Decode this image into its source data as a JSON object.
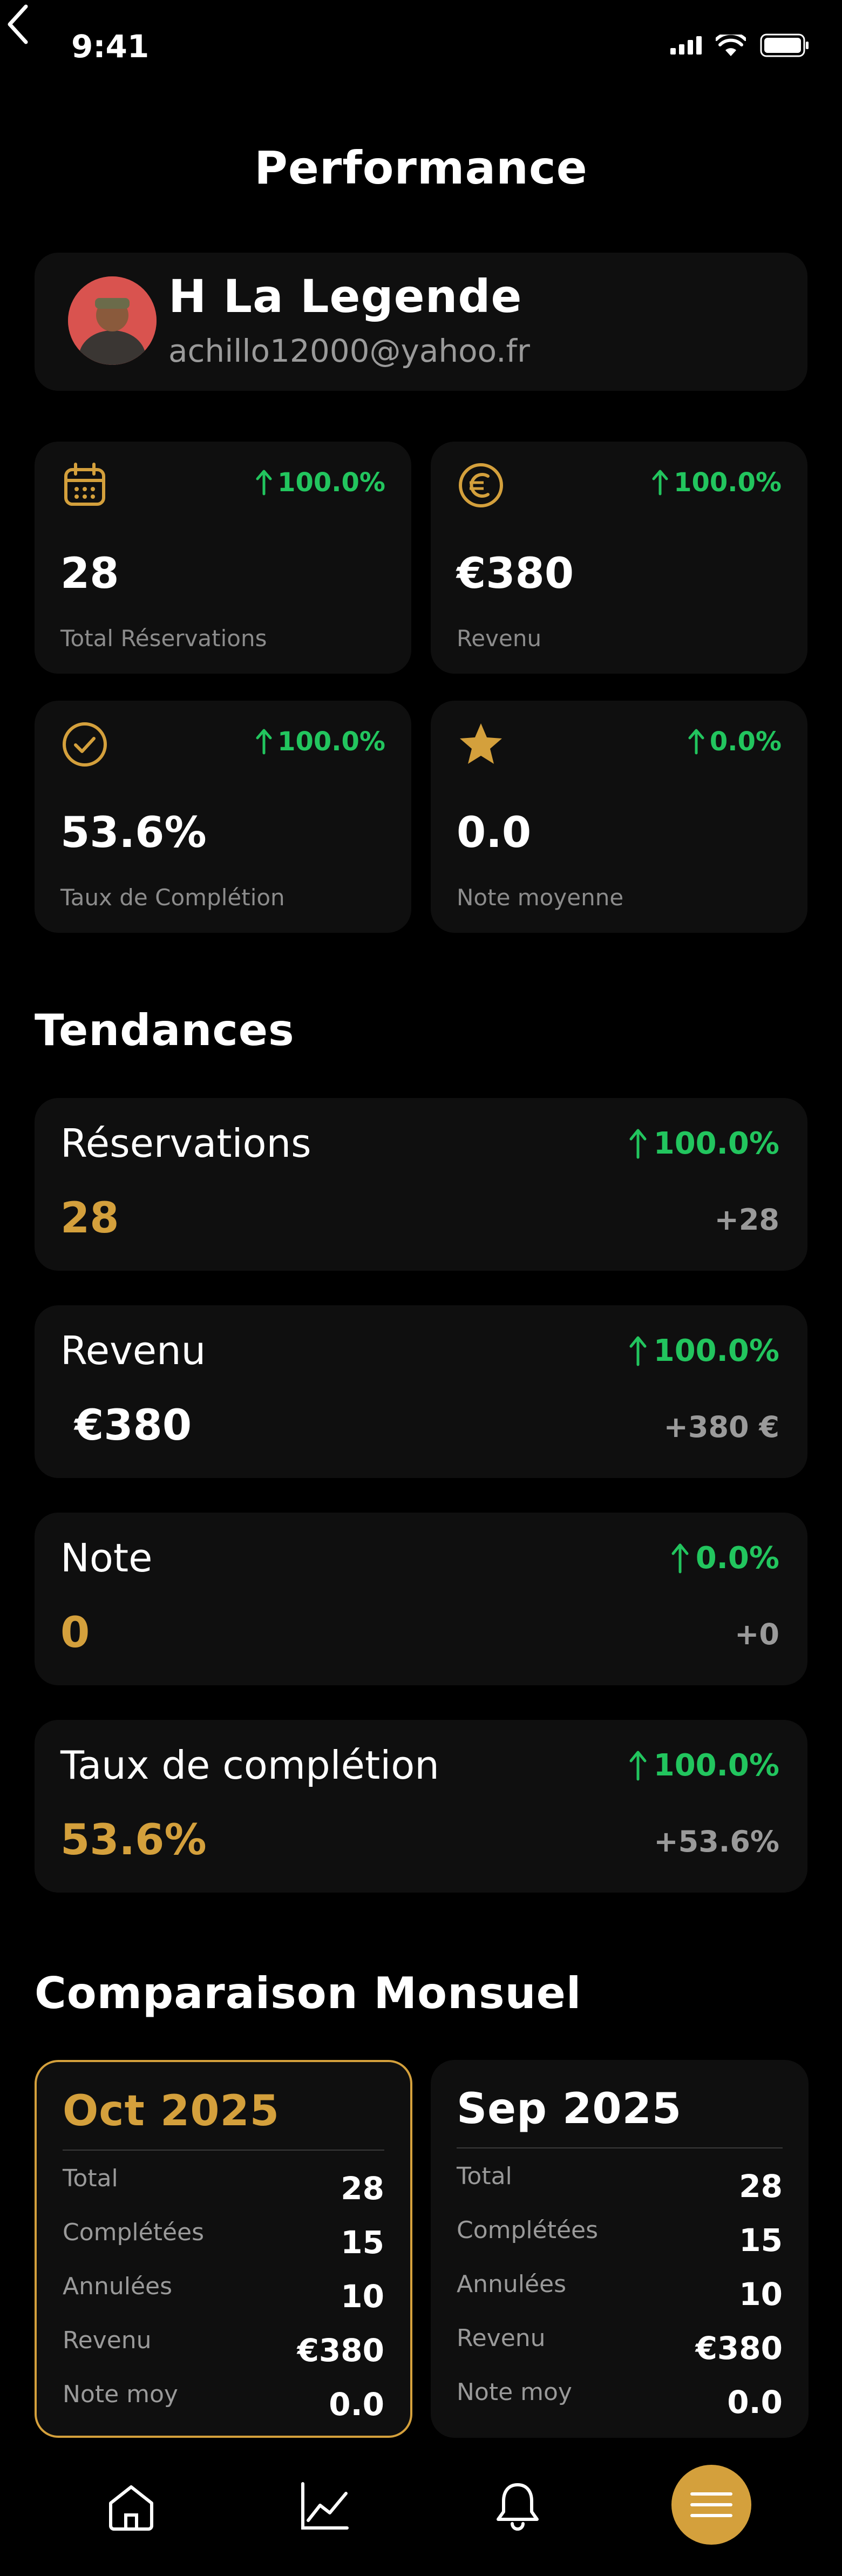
{
  "status_bar": {
    "time": "9:41"
  },
  "header": {
    "title": "Performance"
  },
  "profile": {
    "name": "H La Legende",
    "email": "achillo12000@yahoo.fr"
  },
  "stats": [
    {
      "icon": "calendar-icon",
      "change": "100.0%",
      "value": "28",
      "label": "Total Réservations"
    },
    {
      "icon": "euro-icon",
      "change": "100.0%",
      "value": "€380",
      "label": "Revenu"
    },
    {
      "icon": "check-circle-icon",
      "change": "100.0%",
      "value": "53.6%",
      "label": "Taux de Complétion"
    },
    {
      "icon": "star-icon",
      "change": "0.0%",
      "value": "0.0",
      "label": "Note moyenne"
    }
  ],
  "trends": {
    "heading": "Tendances",
    "items": [
      {
        "name": "Réservations",
        "change": "100.0%",
        "value": "28",
        "delta": "+28"
      },
      {
        "name": "Revenu",
        "change": "100.0%",
        "value": "€380",
        "delta": "+380 €"
      },
      {
        "name": "Note",
        "change": "0.0%",
        "value": "0",
        "delta": "+0"
      },
      {
        "name": "Taux de complétion",
        "change": "100.0%",
        "value": "53.6%",
        "delta": "+53.6%"
      }
    ]
  },
  "monthly": {
    "heading": "Comparaison Monsuel",
    "cards": [
      {
        "month": "Oct 2025",
        "rows": [
          {
            "label": "Total",
            "value": "28"
          },
          {
            "label": "Complétées",
            "value": "15"
          },
          {
            "label": "Annulées",
            "value": "10"
          },
          {
            "label": "Revenu",
            "value": "€380"
          },
          {
            "label": "Note moy",
            "value": "0.0"
          }
        ]
      },
      {
        "month": "Sep 2025",
        "rows": [
          {
            "label": "Total",
            "value": "28"
          },
          {
            "label": "Complétées",
            "value": "15"
          },
          {
            "label": "Annulées",
            "value": "10"
          },
          {
            "label": "Revenu",
            "value": "€380"
          },
          {
            "label": "Note moy",
            "value": "0.0"
          }
        ]
      }
    ]
  },
  "nav": [
    "home-icon",
    "chart-icon",
    "bell-icon",
    "menu-icon"
  ],
  "colors": {
    "accent": "#d4a03c",
    "positive": "#22c55e",
    "background": "#000000",
    "card": "#0f0f0f"
  }
}
